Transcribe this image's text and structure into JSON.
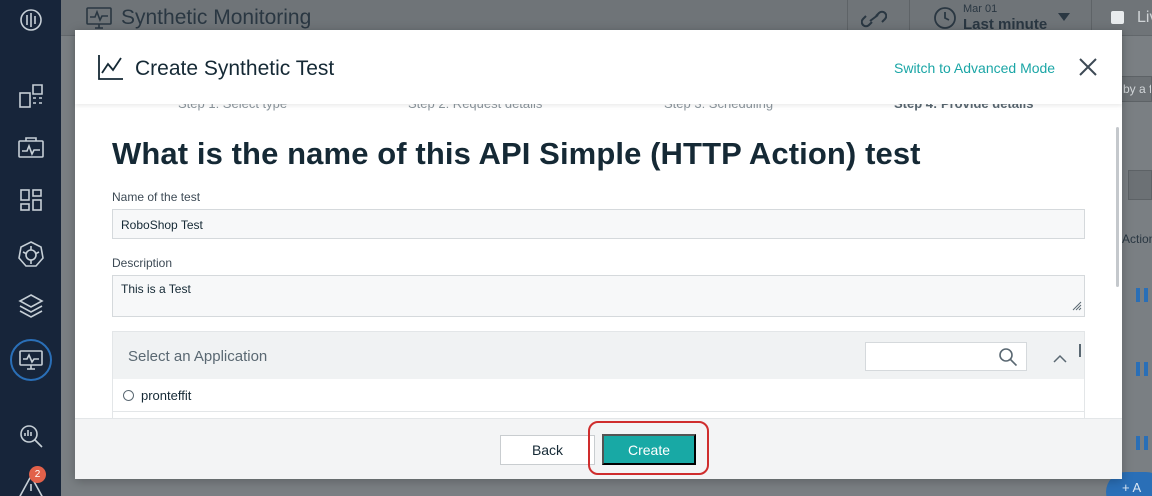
{
  "app": {
    "title": "Synthetic Monitoring",
    "time_range": {
      "date": "Mar 01",
      "label": "Last minute"
    },
    "live_label": "Liv"
  },
  "background": {
    "filter_placeholder": "by a f",
    "column_header": "Action",
    "add_button_label": "+ A"
  },
  "sidebar": {
    "alerts_badge": "2",
    "items": [
      {
        "icon": "logo-icon"
      },
      {
        "icon": "dashboard-icon"
      },
      {
        "icon": "monitor-icon"
      },
      {
        "icon": "apps-grid-icon"
      },
      {
        "icon": "kubernetes-icon"
      },
      {
        "icon": "layers-icon"
      },
      {
        "icon": "synthetic-monitor-icon",
        "active": true
      },
      {
        "icon": "analyze-icon"
      },
      {
        "icon": "alert-icon"
      }
    ]
  },
  "modal": {
    "title": "Create Synthetic Test",
    "advanced_mode_link": "Switch to Advanced Mode",
    "steps": [
      {
        "label": "Step 1: Select type"
      },
      {
        "label": "Step 2: Request details"
      },
      {
        "label": "Step 3: Scheduling"
      },
      {
        "label": "Step 4: Provide details",
        "current": true
      }
    ],
    "heading": "What is the name of this API Simple (HTTP Action) test",
    "name_field": {
      "label": "Name of the test",
      "value": "RoboShop Test"
    },
    "description_field": {
      "label": "Description",
      "value": "This is a Test"
    },
    "application": {
      "title": "Select an Application",
      "search_value": "",
      "options": [
        "pronteffit"
      ]
    },
    "footer": {
      "back_label": "Back",
      "create_label": "Create"
    }
  },
  "colors": {
    "accent": "#18a9a5",
    "highlight": "#cf2d2d",
    "sidebar": "#17253a"
  }
}
